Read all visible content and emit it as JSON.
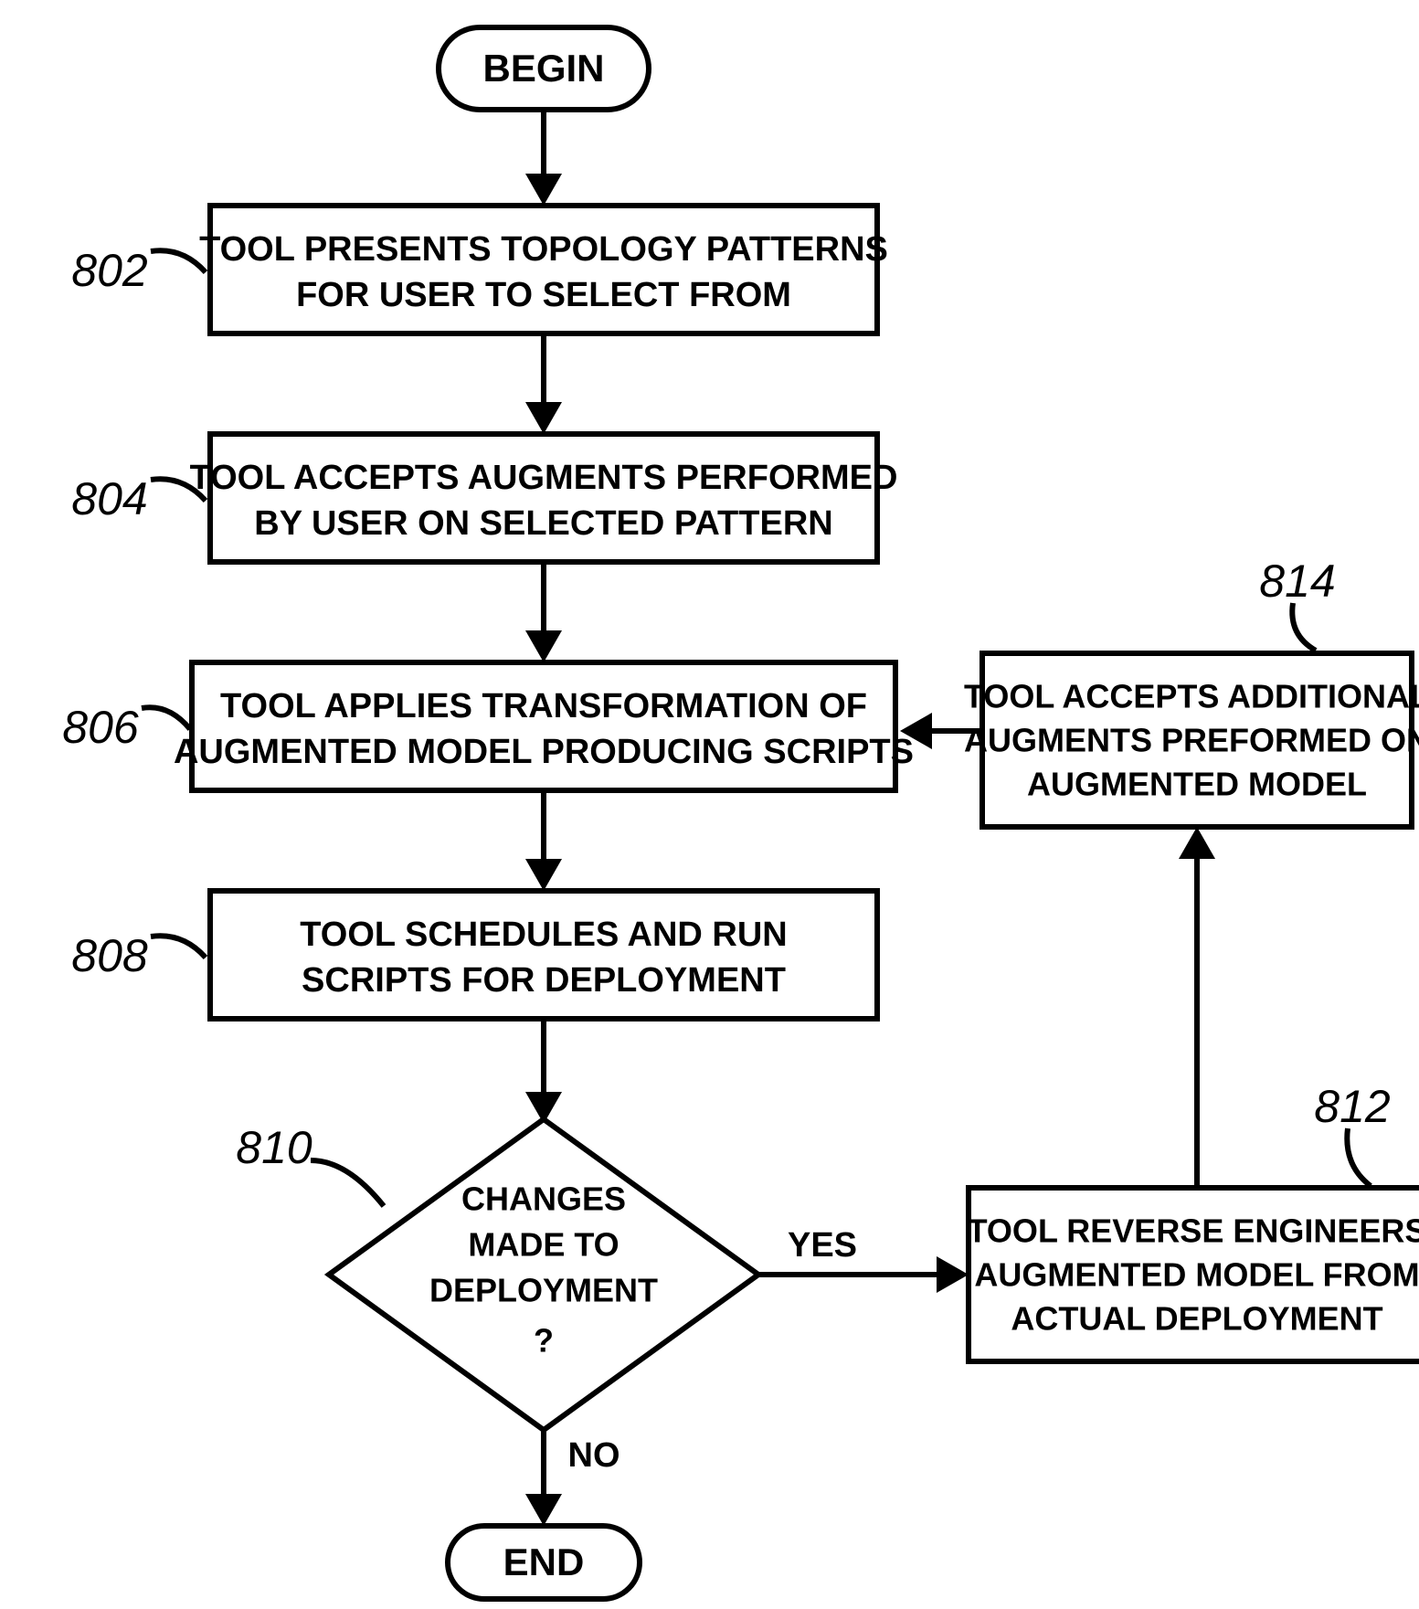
{
  "terminals": {
    "begin": "BEGIN",
    "end": "END"
  },
  "nodes": {
    "n802": {
      "label": "802",
      "lines": [
        "TOOL PRESENTS TOPOLOGY PATTERNS",
        "FOR USER TO SELECT FROM"
      ]
    },
    "n804": {
      "label": "804",
      "lines": [
        "TOOL ACCEPTS AUGMENTS PERFORMED",
        "BY USER ON SELECTED PATTERN"
      ]
    },
    "n806": {
      "label": "806",
      "lines": [
        "TOOL APPLIES TRANSFORMATION OF",
        "AUGMENTED MODEL PRODUCING SCRIPTS"
      ]
    },
    "n808": {
      "label": "808",
      "lines": [
        "TOOL SCHEDULES AND RUN",
        "SCRIPTS FOR DEPLOYMENT"
      ]
    },
    "n810": {
      "label": "810",
      "lines": [
        "CHANGES",
        "MADE TO",
        "DEPLOYMENT",
        "?"
      ]
    },
    "n812": {
      "label": "812",
      "lines": [
        "TOOL REVERSE ENGINEERS",
        "AUGMENTED MODEL FROM",
        "ACTUAL DEPLOYMENT"
      ]
    },
    "n814": {
      "label": "814",
      "lines": [
        "TOOL ACCEPTS ADDITIONAL",
        "AUGMENTS PREFORMED ON",
        "AUGMENTED MODEL"
      ]
    }
  },
  "edges": {
    "yes": "YES",
    "no": "NO"
  }
}
